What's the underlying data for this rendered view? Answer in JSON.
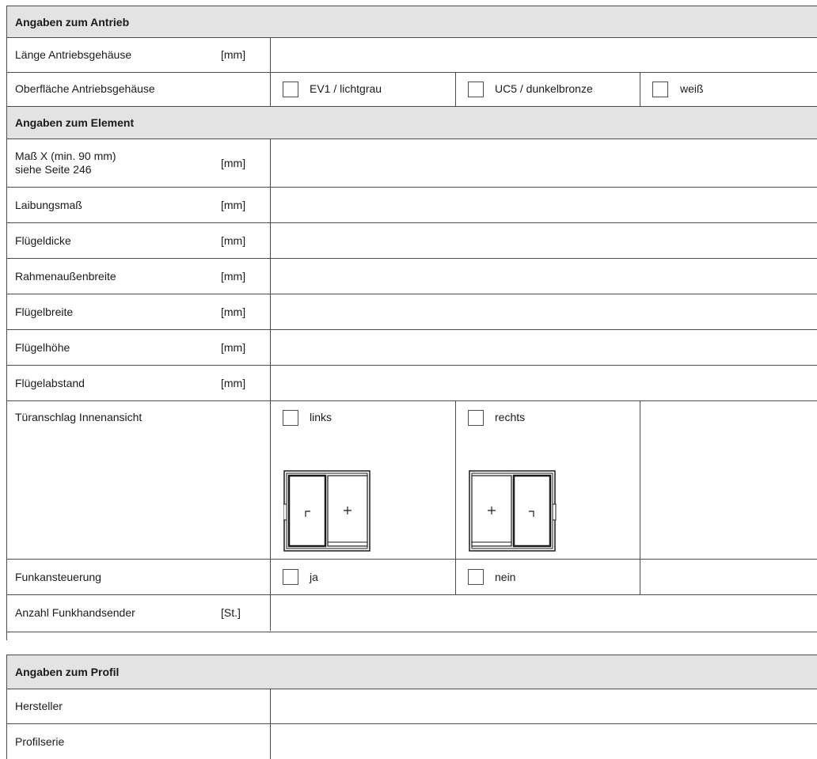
{
  "sections": {
    "antrieb": "Angaben zum Antrieb",
    "element": "Angaben zum Element",
    "profil": "Angaben zum Profil"
  },
  "rows": {
    "laenge": {
      "label": "Länge Antriebsgehäuse",
      "unit": "[mm]"
    },
    "oberflaeche": {
      "label": "Oberfläche Antriebsgehäuse",
      "options": [
        "EV1 / lichtgrau",
        "UC5 / dunkelbronze",
        "weiß"
      ]
    },
    "mass_x": {
      "label_line1": "Maß X (min. 90 mm)",
      "label_line2": "siehe Seite 246",
      "unit": "[mm]"
    },
    "laibung": {
      "label": "Laibungsmaß",
      "unit": "[mm]"
    },
    "fluegeldicke": {
      "label": "Flügeldicke",
      "unit": "[mm]"
    },
    "rahmen": {
      "label": "Rahmenaußenbreite",
      "unit": "[mm]"
    },
    "fluegelbreite": {
      "label": "Flügelbreite",
      "unit": "[mm]"
    },
    "fluegelhoehe": {
      "label": "Flügelhöhe",
      "unit": "[mm]"
    },
    "fluegelabstand": {
      "label": "Flügelabstand",
      "unit": "[mm]"
    },
    "tueranschlag": {
      "label": "Türanschlag Innenansicht",
      "options": [
        "links",
        "rechts"
      ]
    },
    "funk": {
      "label": "Funkansteuerung",
      "options": [
        "ja",
        "nein"
      ]
    },
    "anzahl": {
      "label": "Anzahl Funkhandsender",
      "unit": "[St.]"
    },
    "hersteller": {
      "label": "Hersteller"
    },
    "profilserie": {
      "label": "Profilserie"
    }
  },
  "colors": {
    "header_bg": "#e3e3e3",
    "border": "#4a4a4a"
  }
}
